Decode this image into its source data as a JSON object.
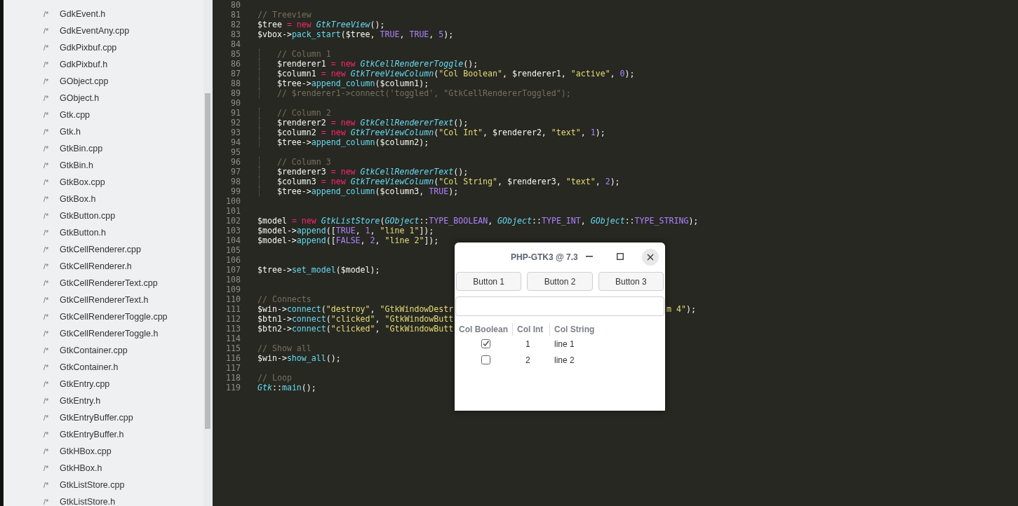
{
  "sidebar": {
    "files": [
      {
        "icon": "/*",
        "name": "GdkEvent.h"
      },
      {
        "icon": "/*",
        "name": "GdkEventAny.cpp"
      },
      {
        "icon": "/*",
        "name": "GdkPixbuf.cpp"
      },
      {
        "icon": "/*",
        "name": "GdkPixbuf.h"
      },
      {
        "icon": "/*",
        "name": "GObject.cpp"
      },
      {
        "icon": "/*",
        "name": "GObject.h"
      },
      {
        "icon": "/*",
        "name": "Gtk.cpp"
      },
      {
        "icon": "/*",
        "name": "Gtk.h"
      },
      {
        "icon": "/*",
        "name": "GtkBin.cpp"
      },
      {
        "icon": "/*",
        "name": "GtkBin.h"
      },
      {
        "icon": "/*",
        "name": "GtkBox.cpp"
      },
      {
        "icon": "/*",
        "name": "GtkBox.h"
      },
      {
        "icon": "/*",
        "name": "GtkButton.cpp"
      },
      {
        "icon": "/*",
        "name": "GtkButton.h"
      },
      {
        "icon": "/*",
        "name": "GtkCellRenderer.cpp"
      },
      {
        "icon": "/*",
        "name": "GtkCellRenderer.h"
      },
      {
        "icon": "/*",
        "name": "GtkCellRendererText.cpp"
      },
      {
        "icon": "/*",
        "name": "GtkCellRendererText.h"
      },
      {
        "icon": "/*",
        "name": "GtkCellRendererToggle.cpp"
      },
      {
        "icon": "/*",
        "name": "GtkCellRendererToggle.h"
      },
      {
        "icon": "/*",
        "name": "GtkContainer.cpp"
      },
      {
        "icon": "/*",
        "name": "GtkContainer.h"
      },
      {
        "icon": "/*",
        "name": "GtkEntry.cpp"
      },
      {
        "icon": "/*",
        "name": "GtkEntry.h"
      },
      {
        "icon": "/*",
        "name": "GtkEntryBuffer.cpp"
      },
      {
        "icon": "/*",
        "name": "GtkEntryBuffer.h"
      },
      {
        "icon": "/*",
        "name": "GtkHBox.cpp"
      },
      {
        "icon": "/*",
        "name": "GtkHBox.h"
      },
      {
        "icon": "/*",
        "name": "GtkListStore.cpp"
      },
      {
        "icon": "/*",
        "name": "GtkListStore.h"
      }
    ]
  },
  "editor": {
    "lines": [
      {
        "n": "80"
      },
      {
        "n": "81",
        "tokens": [
          {
            "kind": "comment",
            "text": "// Treeview"
          }
        ]
      },
      {
        "n": "82",
        "tokens": [
          {
            "kind": "plain",
            "text": "$tree "
          },
          {
            "kind": "keyword",
            "text": "= new "
          },
          {
            "kind": "class",
            "text": "GtkTreeView"
          },
          {
            "kind": "plain",
            "text": "();"
          }
        ]
      },
      {
        "n": "83",
        "tokens": [
          {
            "kind": "plain",
            "text": "$vbox->"
          },
          {
            "kind": "func",
            "text": "pack_start"
          },
          {
            "kind": "plain",
            "text": "($tree, "
          },
          {
            "kind": "const",
            "text": "TRUE"
          },
          {
            "kind": "plain",
            "text": ", "
          },
          {
            "kind": "const",
            "text": "TRUE"
          },
          {
            "kind": "plain",
            "text": ", "
          },
          {
            "kind": "const",
            "text": "5"
          },
          {
            "kind": "plain",
            "text": ");"
          }
        ]
      },
      {
        "n": "84"
      },
      {
        "n": "85",
        "indented": true,
        "tokens": [
          {
            "kind": "comment",
            "text": "// Column 1"
          }
        ]
      },
      {
        "n": "86",
        "indented": true,
        "tokens": [
          {
            "kind": "plain",
            "text": "$renderer1 "
          },
          {
            "kind": "keyword",
            "text": "= new "
          },
          {
            "kind": "class",
            "text": "GtkCellRendererToggle"
          },
          {
            "kind": "plain",
            "text": "();"
          }
        ]
      },
      {
        "n": "87",
        "indented": true,
        "tokens": [
          {
            "kind": "plain",
            "text": "$column1 "
          },
          {
            "kind": "keyword",
            "text": "= new "
          },
          {
            "kind": "class",
            "text": "GtkTreeViewColumn"
          },
          {
            "kind": "plain",
            "text": "("
          },
          {
            "kind": "string",
            "text": "\"Col Boolean\""
          },
          {
            "kind": "plain",
            "text": ", $renderer1, "
          },
          {
            "kind": "string",
            "text": "\"active\""
          },
          {
            "kind": "plain",
            "text": ", "
          },
          {
            "kind": "const",
            "text": "0"
          },
          {
            "kind": "plain",
            "text": ");"
          }
        ]
      },
      {
        "n": "88",
        "indented": true,
        "tokens": [
          {
            "kind": "plain",
            "text": "$tree->"
          },
          {
            "kind": "func",
            "text": "append_column"
          },
          {
            "kind": "plain",
            "text": "($column1);"
          }
        ]
      },
      {
        "n": "89",
        "indented": true,
        "tokens": [
          {
            "kind": "comment",
            "text": "// $renderer1->connect('toggled', \"GtkCellRendererToggled\");"
          }
        ]
      },
      {
        "n": "90"
      },
      {
        "n": "91",
        "indented": true,
        "tokens": [
          {
            "kind": "comment",
            "text": "// Column 2"
          }
        ]
      },
      {
        "n": "92",
        "indented": true,
        "tokens": [
          {
            "kind": "plain",
            "text": "$renderer2 "
          },
          {
            "kind": "keyword",
            "text": "= new "
          },
          {
            "kind": "class",
            "text": "GtkCellRendererText"
          },
          {
            "kind": "plain",
            "text": "();"
          }
        ]
      },
      {
        "n": "93",
        "indented": true,
        "tokens": [
          {
            "kind": "plain",
            "text": "$column2 "
          },
          {
            "kind": "keyword",
            "text": "= new "
          },
          {
            "kind": "class",
            "text": "GtkTreeViewColumn"
          },
          {
            "kind": "plain",
            "text": "("
          },
          {
            "kind": "string",
            "text": "\"Col Int\""
          },
          {
            "kind": "plain",
            "text": ", $renderer2, "
          },
          {
            "kind": "string",
            "text": "\"text\""
          },
          {
            "kind": "plain",
            "text": ", "
          },
          {
            "kind": "const",
            "text": "1"
          },
          {
            "kind": "plain",
            "text": ");"
          }
        ]
      },
      {
        "n": "94",
        "indented": true,
        "tokens": [
          {
            "kind": "plain",
            "text": "$tree->"
          },
          {
            "kind": "func",
            "text": "append_column"
          },
          {
            "kind": "plain",
            "text": "($column2);"
          }
        ]
      },
      {
        "n": "95"
      },
      {
        "n": "96",
        "indented": true,
        "tokens": [
          {
            "kind": "comment",
            "text": "// Column 3"
          }
        ]
      },
      {
        "n": "97",
        "indented": true,
        "tokens": [
          {
            "kind": "plain",
            "text": "$renderer3 "
          },
          {
            "kind": "keyword",
            "text": "= new "
          },
          {
            "kind": "class",
            "text": "GtkCellRendererText"
          },
          {
            "kind": "plain",
            "text": "();"
          }
        ]
      },
      {
        "n": "98",
        "indented": true,
        "tokens": [
          {
            "kind": "plain",
            "text": "$column3 "
          },
          {
            "kind": "keyword",
            "text": "= new "
          },
          {
            "kind": "class",
            "text": "GtkTreeViewColumn"
          },
          {
            "kind": "plain",
            "text": "("
          },
          {
            "kind": "string",
            "text": "\"Col String\""
          },
          {
            "kind": "plain",
            "text": ", $renderer3, "
          },
          {
            "kind": "string",
            "text": "\"text\""
          },
          {
            "kind": "plain",
            "text": ", "
          },
          {
            "kind": "const",
            "text": "2"
          },
          {
            "kind": "plain",
            "text": ");"
          }
        ]
      },
      {
        "n": "99",
        "indented": true,
        "tokens": [
          {
            "kind": "plain",
            "text": "$tree->"
          },
          {
            "kind": "func",
            "text": "append_column"
          },
          {
            "kind": "plain",
            "text": "($column3, "
          },
          {
            "kind": "const",
            "text": "TRUE"
          },
          {
            "kind": "plain",
            "text": ");"
          }
        ]
      },
      {
        "n": "100"
      },
      {
        "n": "101"
      },
      {
        "n": "102",
        "tokens": [
          {
            "kind": "plain",
            "text": "$model "
          },
          {
            "kind": "keyword",
            "text": "= new "
          },
          {
            "kind": "class",
            "text": "GtkListStore"
          },
          {
            "kind": "plain",
            "text": "("
          },
          {
            "kind": "class",
            "text": "GObject"
          },
          {
            "kind": "plain",
            "text": "::"
          },
          {
            "kind": "const",
            "text": "TYPE_BOOLEAN"
          },
          {
            "kind": "plain",
            "text": ", "
          },
          {
            "kind": "class",
            "text": "GObject"
          },
          {
            "kind": "plain",
            "text": "::"
          },
          {
            "kind": "const",
            "text": "TYPE_INT"
          },
          {
            "kind": "plain",
            "text": ", "
          },
          {
            "kind": "class",
            "text": "GObject"
          },
          {
            "kind": "plain",
            "text": "::"
          },
          {
            "kind": "const",
            "text": "TYPE_STRING"
          },
          {
            "kind": "plain",
            "text": ");"
          }
        ]
      },
      {
        "n": "103",
        "tokens": [
          {
            "kind": "plain",
            "text": "$model->"
          },
          {
            "kind": "func",
            "text": "append"
          },
          {
            "kind": "plain",
            "text": "(["
          },
          {
            "kind": "const",
            "text": "TRUE"
          },
          {
            "kind": "plain",
            "text": ", "
          },
          {
            "kind": "const",
            "text": "1"
          },
          {
            "kind": "plain",
            "text": ", "
          },
          {
            "kind": "string",
            "text": "\"line 1\""
          },
          {
            "kind": "plain",
            "text": "]);"
          }
        ]
      },
      {
        "n": "104",
        "tokens": [
          {
            "kind": "plain",
            "text": "$model->"
          },
          {
            "kind": "func",
            "text": "append"
          },
          {
            "kind": "plain",
            "text": "(["
          },
          {
            "kind": "const",
            "text": "FALSE"
          },
          {
            "kind": "plain",
            "text": ", "
          },
          {
            "kind": "const",
            "text": "2"
          },
          {
            "kind": "plain",
            "text": ", "
          },
          {
            "kind": "string",
            "text": "\"line 2\""
          },
          {
            "kind": "plain",
            "text": "]);"
          }
        ]
      },
      {
        "n": "105"
      },
      {
        "n": "106"
      },
      {
        "n": "107",
        "tokens": [
          {
            "kind": "plain",
            "text": "$tree->"
          },
          {
            "kind": "func",
            "text": "set_model"
          },
          {
            "kind": "plain",
            "text": "($model);"
          }
        ]
      },
      {
        "n": "108"
      },
      {
        "n": "109"
      },
      {
        "n": "110",
        "tokens": [
          {
            "kind": "comment",
            "text": "// Connects"
          }
        ]
      },
      {
        "n": "111",
        "tokens": [
          {
            "kind": "plain",
            "text": "$win->"
          },
          {
            "kind": "func",
            "text": "connect"
          },
          {
            "kind": "plain",
            "text": "("
          },
          {
            "kind": "string",
            "text": "\"destroy\""
          },
          {
            "kind": "plain",
            "text": ", "
          },
          {
            "kind": "string",
            "text": "\"GtkWindowDestr"
          }
        ],
        "tail": [
          {
            "kind": "string",
            "text": "m 4\""
          },
          {
            "kind": "plain",
            "text": ");"
          }
        ]
      },
      {
        "n": "112",
        "tokens": [
          {
            "kind": "plain",
            "text": "$btn1->"
          },
          {
            "kind": "func",
            "text": "connect"
          },
          {
            "kind": "plain",
            "text": "("
          },
          {
            "kind": "string",
            "text": "\"clicked\""
          },
          {
            "kind": "plain",
            "text": ", "
          },
          {
            "kind": "string",
            "text": "\"GtkWindowButt"
          }
        ]
      },
      {
        "n": "113",
        "tokens": [
          {
            "kind": "plain",
            "text": "$btn2->"
          },
          {
            "kind": "func",
            "text": "connect"
          },
          {
            "kind": "plain",
            "text": "("
          },
          {
            "kind": "string",
            "text": "\"clicked\""
          },
          {
            "kind": "plain",
            "text": ", "
          },
          {
            "kind": "string",
            "text": "\"GtkWindowButt"
          }
        ]
      },
      {
        "n": "114"
      },
      {
        "n": "115",
        "tokens": [
          {
            "kind": "comment",
            "text": "// Show all"
          }
        ]
      },
      {
        "n": "116",
        "tokens": [
          {
            "kind": "plain",
            "text": "$win->"
          },
          {
            "kind": "func",
            "text": "show_all"
          },
          {
            "kind": "plain",
            "text": "();"
          }
        ]
      },
      {
        "n": "117"
      },
      {
        "n": "118",
        "tokens": [
          {
            "kind": "comment",
            "text": "// Loop"
          }
        ]
      },
      {
        "n": "119",
        "tokens": [
          {
            "kind": "class",
            "text": "Gtk"
          },
          {
            "kind": "plain",
            "text": "::"
          },
          {
            "kind": "func",
            "text": "main"
          },
          {
            "kind": "plain",
            "text": "();"
          }
        ]
      }
    ]
  },
  "dialog": {
    "title": "PHP-GTK3 @ 7.3",
    "buttons": [
      "Button 1",
      "Button 2",
      "Button 3"
    ],
    "columns": [
      "Col Boolean",
      "Col Int",
      "Col String"
    ],
    "rows": [
      {
        "checked": true,
        "int": "1",
        "string": "line 1"
      },
      {
        "checked": false,
        "int": "2",
        "string": "line 2"
      }
    ]
  }
}
